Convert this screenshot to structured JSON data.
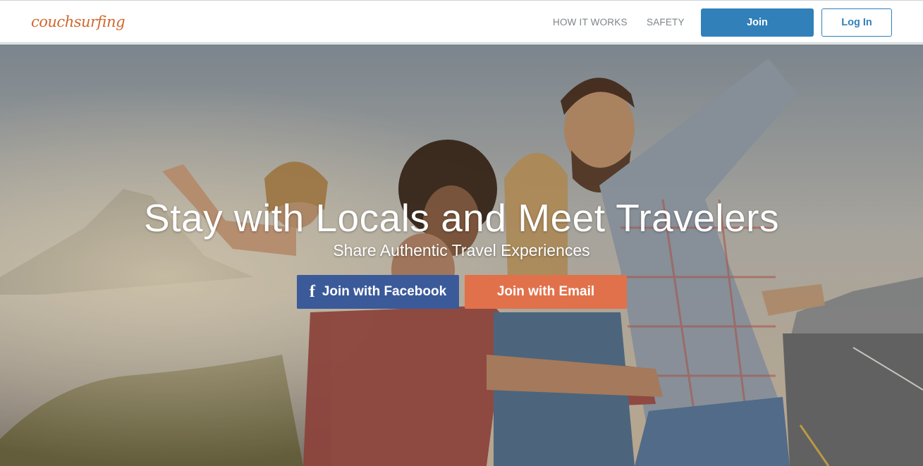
{
  "header": {
    "logo_text": "couchsurfing",
    "nav": [
      {
        "label": "HOW IT WORKS"
      },
      {
        "label": "SAFETY"
      }
    ],
    "join_label": "Join",
    "login_label": "Log In"
  },
  "hero": {
    "title": "Stay with Locals and Meet Travelers",
    "subtitle": "Share Authentic Travel Experiences",
    "facebook_icon": "facebook-f-icon",
    "facebook_label": "Join with Facebook",
    "email_label": "Join with Email",
    "background": "photo-group-of-friends-by-car-at-coast"
  },
  "colors": {
    "brand_orange": "#d0672f",
    "primary_blue": "#3180b9",
    "facebook_blue": "#3b5a9a",
    "email_orange": "#e1714a",
    "nav_gray": "#7d8489"
  }
}
